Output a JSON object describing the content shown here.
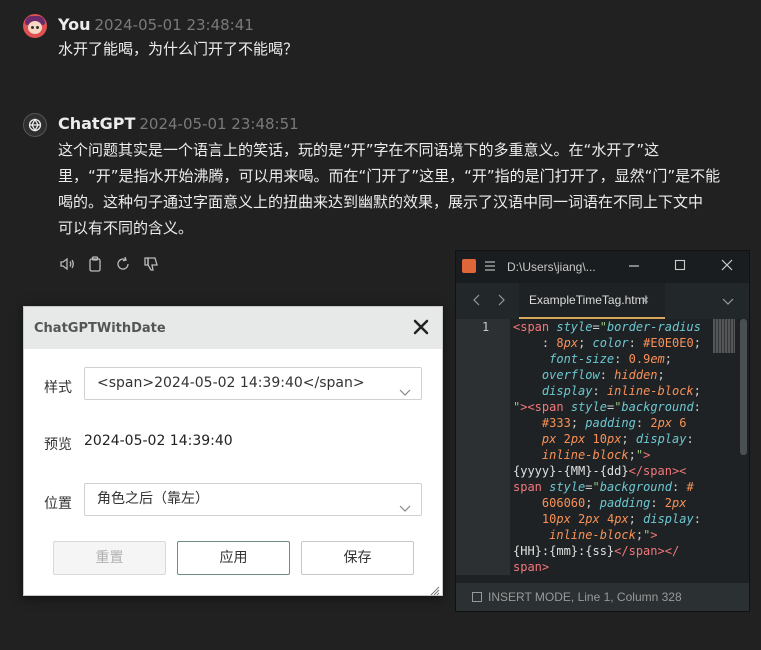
{
  "user_message": {
    "name": "You",
    "timestamp": "2024-05-01 23:48:41",
    "text": "水开了能喝，为什么门开了不能喝？"
  },
  "assistant_message": {
    "name": "ChatGPT",
    "timestamp": "2024-05-01 23:48:51",
    "lines": [
      "这个问题其实是一个语言上的笑话，玩的是“开”字在不同语境下的多重意义。在“水开了”这",
      "里，“开”是指水开始沸腾，可以用来喝。而在“门开了”这里，“开”指的是门打开了，显然“门”是不能",
      "喝的。这种句子通过字面意义上的扭曲来达到幽默的效果，展示了汉语中同一词语在不同上下文中",
      "可以有不同的含义。"
    ],
    "action_icons": [
      "read-aloud-icon",
      "copy-icon",
      "regenerate-icon",
      "thumbs-down-icon"
    ]
  },
  "dialog": {
    "title": "ChatGPTWithDate",
    "style_label": "样式",
    "style_value": "<span>2024-05-02 14:39:40</span>",
    "preview_label": "预览",
    "preview_value": "2024-05-02 14:39:40",
    "position_label": "位置",
    "position_value": "角色之后（靠左）",
    "buttons": {
      "reset": "重置",
      "apply": "应用",
      "save": "保存"
    }
  },
  "editor": {
    "path": "D:\\Users\\jiang\\...",
    "tab_name": "ExampleTimeTag.html",
    "line_number": "1",
    "status": "INSERT MODE, Line 1, Column 328"
  }
}
